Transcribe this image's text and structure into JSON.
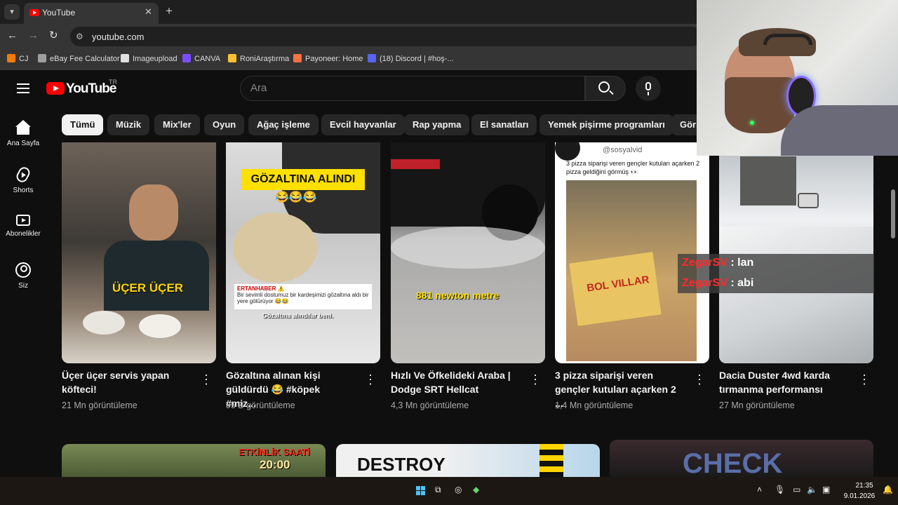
{
  "browser": {
    "tab_title": "YouTube",
    "tab_close": "✕",
    "new_tab": "+",
    "url": "youtube.com",
    "bookmarks": [
      {
        "label": "CJ",
        "color": "#f57c00"
      },
      {
        "label": "eBay Fee Calculator",
        "color": "#9e9e9e"
      },
      {
        "label": "Imageupload",
        "color": "#e0e0e0"
      },
      {
        "label": "CANVA",
        "color": "#7c4dff"
      },
      {
        "label": "RoniAraştırma",
        "color": "#fbc02d"
      },
      {
        "label": "Payoneer: Home",
        "color": "#ff7043"
      },
      {
        "label": "(18) Discord | #hoş-...",
        "color": "#5865f2"
      }
    ]
  },
  "youtube": {
    "logo_text": "YouTube",
    "region": "TR",
    "search_placeholder": "Ara",
    "brand_color": "#ff0000"
  },
  "sidebar": {
    "items": [
      {
        "label": "Ana Sayfa",
        "icon": "home-icon"
      },
      {
        "label": "Shorts",
        "icon": "shorts-icon"
      },
      {
        "label": "Abonelikler",
        "icon": "subscriptions-icon"
      },
      {
        "label": "Siz",
        "icon": "you-icon"
      }
    ]
  },
  "chips": [
    "Tümü",
    "Müzik",
    "Mix'ler",
    "Oyun",
    "Ağaç işleme",
    "Evcil hayvanlar",
    "Rap yapma",
    "El sanatları",
    "Yemek pişirme programları",
    "Görs"
  ],
  "videos": [
    {
      "title": "Üçer üçer servis yapan köfteci!",
      "views": "21 Mn görüntüleme",
      "overlay": "ÜÇER ÜÇER"
    },
    {
      "title": "Gözaltına alınan kişi güldürdü 😂 #köpek #miz...",
      "views": "95 B görüntüleme",
      "overlay": "GÖZALTINA ALINDI",
      "overlay_emoji": "😂😂😂",
      "news_source": "ERTANHABER ⚠️",
      "news_text": "Bir sevimli dostumuz bir kardeşimizi gözaltına aldı bir yere götürüyor 😂😂",
      "caption": "Gözaltına alındılar beni."
    },
    {
      "title": "Hızlı Ve Öfkelideki Araba | Dodge SRT Hellcat",
      "views": "4,3 Mn görüntüleme",
      "overlay": "881 newton metre"
    },
    {
      "title": "3 pizza siparişi veren gençler kutuları açarken 2 ...",
      "views": "1,4 Mn görüntüleme",
      "handle": "@sosyalvid",
      "post_text": "3 pizza siparişi veren gençler kutuları açarken 2 pizza geldiğini görmüş 👀",
      "box_text": "BOL VILLAR"
    },
    {
      "title": "Dacia Duster 4wd karda tırmanma performansı",
      "views": "27 Mn görüntüleme"
    }
  ],
  "bottom_row": {
    "left_overlay": "ETKİNLİK SAATİ",
    "left_time": "20:00",
    "middle_overlay": "DESTROY",
    "right_overlay": "CHECK"
  },
  "stream_chat": [
    {
      "user": "ZegarSV",
      "message": ": lan"
    },
    {
      "user": "ZegarSV",
      "message": ": abi"
    }
  ],
  "taskbar": {
    "time": "21:35",
    "date": "9.01.2026"
  }
}
